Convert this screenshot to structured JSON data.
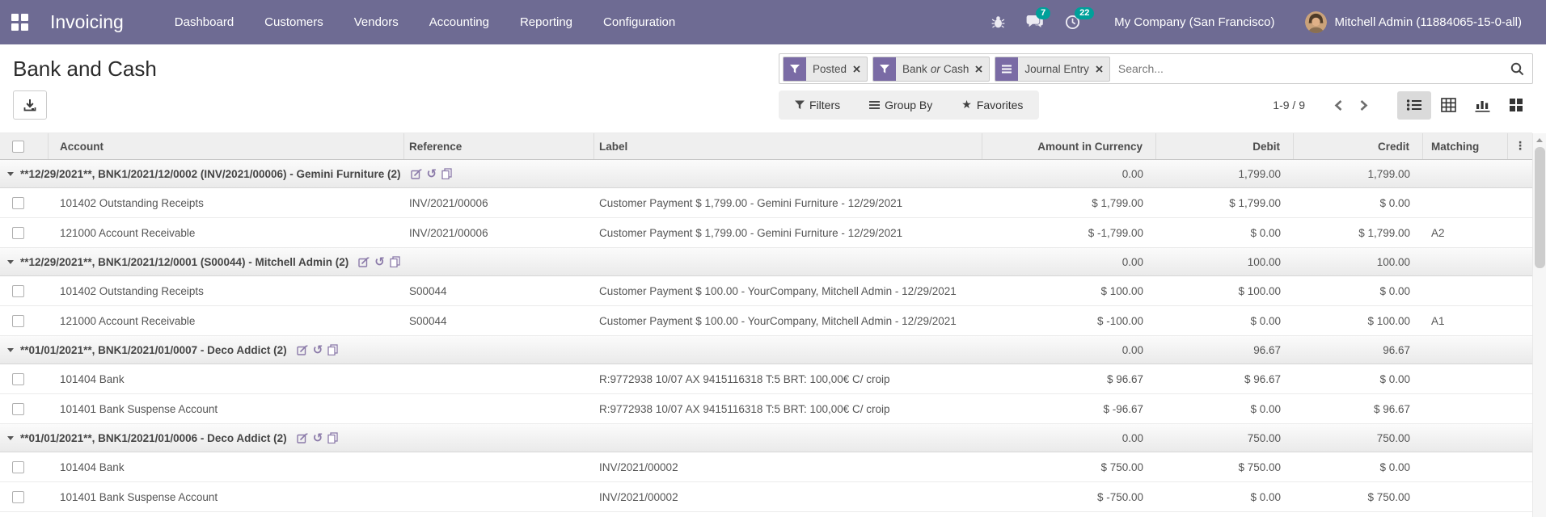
{
  "nav": {
    "app_name": "Invoicing",
    "menus": [
      "Dashboard",
      "Customers",
      "Vendors",
      "Accounting",
      "Reporting",
      "Configuration"
    ],
    "messages_badge": "7",
    "activities_badge": "22",
    "company": "My Company (San Francisco)",
    "user": "Mitchell Admin (11884065-15-0-all)"
  },
  "page": {
    "title": "Bank and Cash"
  },
  "search": {
    "placeholder": "Search...",
    "facets": [
      {
        "icon": "filter-icon",
        "label": "Posted"
      },
      {
        "icon": "filter-icon",
        "parts": [
          "Bank",
          "or",
          "Cash"
        ]
      },
      {
        "icon": "group-by-icon",
        "label": "Journal Entry"
      }
    ]
  },
  "controls": {
    "filters_label": "Filters",
    "group_by_label": "Group By",
    "favorites_label": "Favorites",
    "pager_text": "1-9 / 9",
    "views": [
      "list",
      "pivot",
      "graph",
      "kanban"
    ],
    "active_view": "list"
  },
  "icons": {
    "apps": "grid-2x2",
    "bug": "bug",
    "messages": "chat-bubbles",
    "activities": "clock",
    "search": "magnifier",
    "export": "download-tray",
    "filters": "funnel",
    "group_by": "bars",
    "favorites": "star",
    "remove_facet": "x-cross",
    "group_actions": [
      "edit-pencil",
      "undo-arrow",
      "duplicate-pages"
    ]
  },
  "colors": {
    "navbar": "#6e6b93",
    "badge": "#00a09a",
    "facet_icon": "#7a6ba5",
    "group_action_icons": "#8b7aa9",
    "active_view_bg": "#dadada"
  },
  "table": {
    "headers": [
      "Account",
      "Reference",
      "Label",
      "Amount in Currency",
      "Debit",
      "Credit",
      "Matching"
    ],
    "rows": [
      {
        "type": "group",
        "label": "**12/29/2021**, BNK1/2021/12/0002 (INV/2021/00006) - Gemini Furniture (2)",
        "amount": "0.00",
        "debit": "1,799.00",
        "credit": "1,799.00"
      },
      {
        "type": "line",
        "account": "101402 Outstanding Receipts",
        "reference": "INV/2021/00006",
        "label": "Customer Payment $ 1,799.00 - Gemini Furniture - 12/29/2021",
        "amount": "$ 1,799.00",
        "debit": "$ 1,799.00",
        "credit": "$ 0.00",
        "matching": ""
      },
      {
        "type": "line",
        "account": "121000 Account Receivable",
        "reference": "INV/2021/00006",
        "label": "Customer Payment $ 1,799.00 - Gemini Furniture - 12/29/2021",
        "amount": "$ -1,799.00",
        "debit": "$ 0.00",
        "credit": "$ 1,799.00",
        "matching": "A2"
      },
      {
        "type": "group",
        "label": "**12/29/2021**, BNK1/2021/12/0001 (S00044) - Mitchell Admin (2)",
        "amount": "0.00",
        "debit": "100.00",
        "credit": "100.00"
      },
      {
        "type": "line",
        "account": "101402 Outstanding Receipts",
        "reference": "S00044",
        "label": "Customer Payment $ 100.00 - YourCompany, Mitchell Admin - 12/29/2021",
        "amount": "$ 100.00",
        "debit": "$ 100.00",
        "credit": "$ 0.00",
        "matching": ""
      },
      {
        "type": "line",
        "account": "121000 Account Receivable",
        "reference": "S00044",
        "label": "Customer Payment $ 100.00 - YourCompany, Mitchell Admin - 12/29/2021",
        "amount": "$ -100.00",
        "debit": "$ 0.00",
        "credit": "$ 100.00",
        "matching": "A1"
      },
      {
        "type": "group",
        "label": "**01/01/2021**, BNK1/2021/01/0007 - Deco Addict (2)",
        "amount": "0.00",
        "debit": "96.67",
        "credit": "96.67"
      },
      {
        "type": "line",
        "account": "101404 Bank",
        "reference": "",
        "label": "R:9772938 10/07 AX 9415116318 T:5 BRT: 100,00€ C/ croip",
        "amount": "$ 96.67",
        "debit": "$ 96.67",
        "credit": "$ 0.00",
        "matching": ""
      },
      {
        "type": "line",
        "account": "101401 Bank Suspense Account",
        "reference": "",
        "label": "R:9772938 10/07 AX 9415116318 T:5 BRT: 100,00€ C/ croip",
        "amount": "$ -96.67",
        "debit": "$ 0.00",
        "credit": "$ 96.67",
        "matching": ""
      },
      {
        "type": "group",
        "label": "**01/01/2021**, BNK1/2021/01/0006 - Deco Addict (2)",
        "amount": "0.00",
        "debit": "750.00",
        "credit": "750.00"
      },
      {
        "type": "line",
        "account": "101404 Bank",
        "reference": "",
        "label": "INV/2021/00002",
        "amount": "$ 750.00",
        "debit": "$ 750.00",
        "credit": "$ 0.00",
        "matching": ""
      },
      {
        "type": "line",
        "account": "101401 Bank Suspense Account",
        "reference": "",
        "label": "INV/2021/00002",
        "amount": "$ -750.00",
        "debit": "$ 0.00",
        "credit": "$ 750.00",
        "matching": ""
      }
    ]
  }
}
